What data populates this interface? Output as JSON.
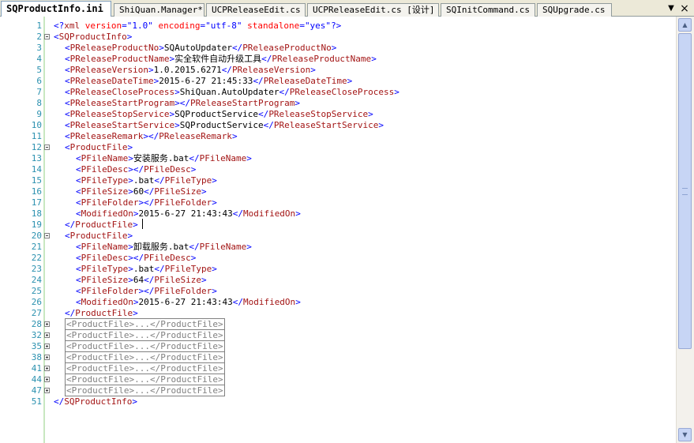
{
  "tabs": [
    {
      "label": "SQProductInfo.ini",
      "active": true
    },
    {
      "label": "ShiQuan.Manager*",
      "active": false
    },
    {
      "label": "UCPReleaseEdit.cs",
      "active": false
    },
    {
      "label": "UCPReleaseEdit.cs [设计]",
      "active": false
    },
    {
      "label": "SQInitCommand.cs",
      "active": false
    },
    {
      "label": "SQUpgrade.cs",
      "active": false
    }
  ],
  "tab_controls": {
    "dropdown_icon": "▼",
    "close_icon": "×"
  },
  "scrollbar": {
    "up_icon": "▲",
    "down_icon": "▼"
  },
  "editor": {
    "lines": [
      {
        "n": "1",
        "fold": "",
        "indent": 0,
        "segs": [
          [
            "br",
            "<?"
          ],
          [
            "tag",
            "xml"
          ],
          [
            "txt",
            " "
          ],
          [
            "attr",
            "version"
          ],
          [
            "br",
            "="
          ],
          [
            "val",
            "\"1.0\""
          ],
          [
            "txt",
            " "
          ],
          [
            "attr",
            "encoding"
          ],
          [
            "br",
            "="
          ],
          [
            "val",
            "\"utf-8\""
          ],
          [
            "txt",
            " "
          ],
          [
            "attr",
            "standalone"
          ],
          [
            "br",
            "="
          ],
          [
            "val",
            "\"yes\""
          ],
          [
            "br",
            "?>"
          ]
        ]
      },
      {
        "n": "2",
        "fold": "minus",
        "indent": 0,
        "segs": [
          [
            "br",
            "<"
          ],
          [
            "tag",
            "SQProductInfo"
          ],
          [
            "br",
            ">"
          ]
        ]
      },
      {
        "n": "3",
        "fold": "",
        "indent": 1,
        "segs": [
          [
            "br",
            "<"
          ],
          [
            "tag",
            "PReleaseProductNo"
          ],
          [
            "br",
            ">"
          ],
          [
            "txt",
            "SQAutoUpdater"
          ],
          [
            "br",
            "</"
          ],
          [
            "tag",
            "PReleaseProductNo"
          ],
          [
            "br",
            ">"
          ]
        ]
      },
      {
        "n": "4",
        "fold": "",
        "indent": 1,
        "segs": [
          [
            "br",
            "<"
          ],
          [
            "tag",
            "PReleaseProductName"
          ],
          [
            "br",
            ">"
          ],
          [
            "txt",
            "实全软件自动升级工具"
          ],
          [
            "br",
            "</"
          ],
          [
            "tag",
            "PReleaseProductName"
          ],
          [
            "br",
            ">"
          ]
        ]
      },
      {
        "n": "5",
        "fold": "",
        "indent": 1,
        "segs": [
          [
            "br",
            "<"
          ],
          [
            "tag",
            "PReleaseVersion"
          ],
          [
            "br",
            ">"
          ],
          [
            "txt",
            "1.0.2015.6271"
          ],
          [
            "br",
            "</"
          ],
          [
            "tag",
            "PReleaseVersion"
          ],
          [
            "br",
            ">"
          ]
        ]
      },
      {
        "n": "6",
        "fold": "",
        "indent": 1,
        "segs": [
          [
            "br",
            "<"
          ],
          [
            "tag",
            "PReleaseDateTime"
          ],
          [
            "br",
            ">"
          ],
          [
            "txt",
            "2015-6-27 21:45:33"
          ],
          [
            "br",
            "</"
          ],
          [
            "tag",
            "PReleaseDateTime"
          ],
          [
            "br",
            ">"
          ]
        ]
      },
      {
        "n": "7",
        "fold": "",
        "indent": 1,
        "segs": [
          [
            "br",
            "<"
          ],
          [
            "tag",
            "PReleaseCloseProcess"
          ],
          [
            "br",
            ">"
          ],
          [
            "txt",
            "ShiQuan.AutoUpdater"
          ],
          [
            "br",
            "</"
          ],
          [
            "tag",
            "PReleaseCloseProcess"
          ],
          [
            "br",
            ">"
          ]
        ]
      },
      {
        "n": "8",
        "fold": "",
        "indent": 1,
        "segs": [
          [
            "br",
            "<"
          ],
          [
            "tag",
            "PReleaseStartProgram"
          ],
          [
            "br",
            "></"
          ],
          [
            "tag",
            "PReleaseStartProgram"
          ],
          [
            "br",
            ">"
          ]
        ]
      },
      {
        "n": "9",
        "fold": "",
        "indent": 1,
        "segs": [
          [
            "br",
            "<"
          ],
          [
            "tag",
            "PReleaseStopService"
          ],
          [
            "br",
            ">"
          ],
          [
            "txt",
            "SQProductService"
          ],
          [
            "br",
            "</"
          ],
          [
            "tag",
            "PReleaseStopService"
          ],
          [
            "br",
            ">"
          ]
        ]
      },
      {
        "n": "10",
        "fold": "",
        "indent": 1,
        "segs": [
          [
            "br",
            "<"
          ],
          [
            "tag",
            "PReleaseStartService"
          ],
          [
            "br",
            ">"
          ],
          [
            "txt",
            "SQProductService"
          ],
          [
            "br",
            "</"
          ],
          [
            "tag",
            "PReleaseStartService"
          ],
          [
            "br",
            ">"
          ]
        ]
      },
      {
        "n": "11",
        "fold": "",
        "indent": 1,
        "segs": [
          [
            "br",
            "<"
          ],
          [
            "tag",
            "PReleaseRemark"
          ],
          [
            "br",
            "></"
          ],
          [
            "tag",
            "PReleaseRemark"
          ],
          [
            "br",
            ">"
          ]
        ]
      },
      {
        "n": "12",
        "fold": "minus",
        "indent": 1,
        "segs": [
          [
            "br",
            "<"
          ],
          [
            "tag",
            "ProductFile"
          ],
          [
            "br",
            ">"
          ]
        ]
      },
      {
        "n": "13",
        "fold": "",
        "indent": 2,
        "segs": [
          [
            "br",
            "<"
          ],
          [
            "tag",
            "PFileName"
          ],
          [
            "br",
            ">"
          ],
          [
            "txt",
            "安装服务.bat"
          ],
          [
            "br",
            "</"
          ],
          [
            "tag",
            "PFileName"
          ],
          [
            "br",
            ">"
          ]
        ]
      },
      {
        "n": "14",
        "fold": "",
        "indent": 2,
        "segs": [
          [
            "br",
            "<"
          ],
          [
            "tag",
            "PFileDesc"
          ],
          [
            "br",
            "></"
          ],
          [
            "tag",
            "PFileDesc"
          ],
          [
            "br",
            ">"
          ]
        ]
      },
      {
        "n": "15",
        "fold": "",
        "indent": 2,
        "segs": [
          [
            "br",
            "<"
          ],
          [
            "tag",
            "PFileType"
          ],
          [
            "br",
            ">"
          ],
          [
            "txt",
            ".bat"
          ],
          [
            "br",
            "</"
          ],
          [
            "tag",
            "PFileType"
          ],
          [
            "br",
            ">"
          ]
        ]
      },
      {
        "n": "16",
        "fold": "",
        "indent": 2,
        "segs": [
          [
            "br",
            "<"
          ],
          [
            "tag",
            "PFileSize"
          ],
          [
            "br",
            ">"
          ],
          [
            "txt",
            "60"
          ],
          [
            "br",
            "</"
          ],
          [
            "tag",
            "PFileSize"
          ],
          [
            "br",
            ">"
          ]
        ]
      },
      {
        "n": "17",
        "fold": "",
        "indent": 2,
        "segs": [
          [
            "br",
            "<"
          ],
          [
            "tag",
            "PFileFolder"
          ],
          [
            "br",
            "></"
          ],
          [
            "tag",
            "PFileFolder"
          ],
          [
            "br",
            ">"
          ]
        ]
      },
      {
        "n": "18",
        "fold": "",
        "indent": 2,
        "segs": [
          [
            "br",
            "<"
          ],
          [
            "tag",
            "ModifiedOn"
          ],
          [
            "br",
            ">"
          ],
          [
            "txt",
            "2015-6-27 21:43:43"
          ],
          [
            "br",
            "</"
          ],
          [
            "tag",
            "ModifiedOn"
          ],
          [
            "br",
            ">"
          ]
        ]
      },
      {
        "n": "19",
        "fold": "",
        "indent": 1,
        "segs": [
          [
            "br",
            "</"
          ],
          [
            "tag",
            "ProductFile"
          ],
          [
            "br",
            ">"
          ]
        ]
      },
      {
        "n": "20",
        "fold": "minus",
        "indent": 1,
        "segs": [
          [
            "br",
            "<"
          ],
          [
            "tag",
            "ProductFile"
          ],
          [
            "br",
            ">"
          ]
        ]
      },
      {
        "n": "21",
        "fold": "",
        "indent": 2,
        "segs": [
          [
            "br",
            "<"
          ],
          [
            "tag",
            "PFileName"
          ],
          [
            "br",
            ">"
          ],
          [
            "txt",
            "卸载服务.bat"
          ],
          [
            "br",
            "</"
          ],
          [
            "tag",
            "PFileName"
          ],
          [
            "br",
            ">"
          ]
        ]
      },
      {
        "n": "22",
        "fold": "",
        "indent": 2,
        "segs": [
          [
            "br",
            "<"
          ],
          [
            "tag",
            "PFileDesc"
          ],
          [
            "br",
            "></"
          ],
          [
            "tag",
            "PFileDesc"
          ],
          [
            "br",
            ">"
          ]
        ]
      },
      {
        "n": "23",
        "fold": "",
        "indent": 2,
        "segs": [
          [
            "br",
            "<"
          ],
          [
            "tag",
            "PFileType"
          ],
          [
            "br",
            ">"
          ],
          [
            "txt",
            ".bat"
          ],
          [
            "br",
            "</"
          ],
          [
            "tag",
            "PFileType"
          ],
          [
            "br",
            ">"
          ]
        ]
      },
      {
        "n": "24",
        "fold": "",
        "indent": 2,
        "segs": [
          [
            "br",
            "<"
          ],
          [
            "tag",
            "PFileSize"
          ],
          [
            "br",
            ">"
          ],
          [
            "txt",
            "64"
          ],
          [
            "br",
            "</"
          ],
          [
            "tag",
            "PFileSize"
          ],
          [
            "br",
            ">"
          ]
        ]
      },
      {
        "n": "25",
        "fold": "",
        "indent": 2,
        "segs": [
          [
            "br",
            "<"
          ],
          [
            "tag",
            "PFileFolder"
          ],
          [
            "br",
            "></"
          ],
          [
            "tag",
            "PFileFolder"
          ],
          [
            "br",
            ">"
          ]
        ]
      },
      {
        "n": "26",
        "fold": "",
        "indent": 2,
        "segs": [
          [
            "br",
            "<"
          ],
          [
            "tag",
            "ModifiedOn"
          ],
          [
            "br",
            ">"
          ],
          [
            "txt",
            "2015-6-27 21:43:43"
          ],
          [
            "br",
            "</"
          ],
          [
            "tag",
            "ModifiedOn"
          ],
          [
            "br",
            ">"
          ]
        ]
      },
      {
        "n": "27",
        "fold": "",
        "indent": 1,
        "segs": [
          [
            "br",
            "</"
          ],
          [
            "tag",
            "ProductFile"
          ],
          [
            "br",
            ">"
          ]
        ]
      },
      {
        "n": "28",
        "fold": "plus",
        "indent": 1,
        "collapsed": "<ProductFile>...</ProductFile>"
      },
      {
        "n": "32",
        "fold": "plus",
        "indent": 1,
        "collapsed": "<ProductFile>...</ProductFile>"
      },
      {
        "n": "35",
        "fold": "plus",
        "indent": 1,
        "collapsed": "<ProductFile>...</ProductFile>"
      },
      {
        "n": "38",
        "fold": "plus",
        "indent": 1,
        "collapsed": "<ProductFile>...</ProductFile>"
      },
      {
        "n": "41",
        "fold": "plus",
        "indent": 1,
        "collapsed": "<ProductFile>...</ProductFile>"
      },
      {
        "n": "44",
        "fold": "plus",
        "indent": 1,
        "collapsed": "<ProductFile>...</ProductFile>"
      },
      {
        "n": "47",
        "fold": "plus",
        "indent": 1,
        "collapsed": "<ProductFile>...</ProductFile>"
      },
      {
        "n": "51",
        "fold": "",
        "indent": 0,
        "segs": [
          [
            "br",
            "</"
          ],
          [
            "tag",
            "SQProductInfo"
          ],
          [
            "br",
            ">"
          ]
        ]
      }
    ]
  }
}
